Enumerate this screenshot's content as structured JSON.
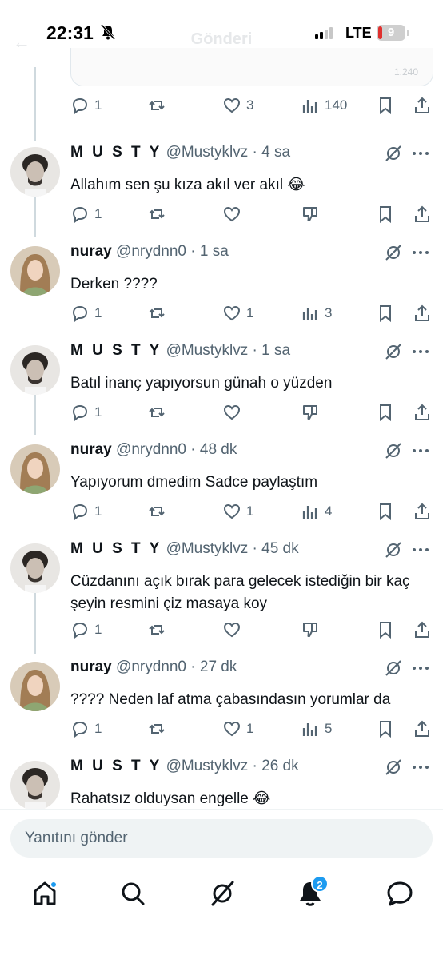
{
  "status_bar": {
    "time": "22:31",
    "network": "LTE",
    "battery": "9"
  },
  "header": {
    "title": "Gönderi"
  },
  "quoted_card": {
    "count": "1.240"
  },
  "top_actions": {
    "replies": "1",
    "likes": "3",
    "views": "140"
  },
  "tweets": [
    {
      "name": "M U S T Y",
      "handle": "@Mustyklvz",
      "time": "4 sa",
      "text": "Allahım sen şu kıza akıl ver akıl 😂",
      "replies": "1",
      "likes": "",
      "views": ""
    },
    {
      "name": "nuray",
      "handle": "@nrydnn0",
      "time": "1 sa",
      "text": "Derken ????",
      "replies": "1",
      "likes": "1",
      "views": "3"
    },
    {
      "name": "M U S T Y",
      "handle": "@Mustyklvz",
      "time": "1 sa",
      "text": "Batıl inanç yapıyorsun günah o yüzden",
      "replies": "1",
      "likes": "",
      "views": ""
    },
    {
      "name": "nuray",
      "handle": "@nrydnn0",
      "time": "48 dk",
      "text": "Yapıyorum dmedim Sadce paylaştım",
      "replies": "1",
      "likes": "1",
      "views": "4"
    },
    {
      "name": "M U S T Y",
      "handle": "@Mustyklvz",
      "time": "45 dk",
      "text": "Cüzdanını açık bırak para gelecek istediğin bir kaç şeyin resmini çiz masaya koy",
      "replies": "1",
      "likes": "",
      "views": ""
    },
    {
      "name": "nuray",
      "handle": "@nrydnn0",
      "time": "27 dk",
      "text": "???? Neden laf atma çabasındasın yorumlar da",
      "replies": "1",
      "likes": "1",
      "views": "5"
    },
    {
      "name": "M U S T Y",
      "handle": "@Mustyklvz",
      "time": "26 dk",
      "text": "Rahatsız olduysan engelle 😂"
    }
  ],
  "reply_bar": {
    "placeholder": "Yanıtını gönder"
  },
  "tab_bar": {
    "notifications_badge": "2"
  },
  "colors": {
    "accent": "#1d9bf0",
    "text": "#0f1419",
    "muted": "#536471"
  },
  "icons": [
    "reply-icon",
    "retweet-icon",
    "like-icon",
    "views-icon",
    "downvote-icon",
    "bookmark-icon",
    "share-icon",
    "grok-icon",
    "more-icon",
    "home-icon",
    "search-icon",
    "grok-tab-icon",
    "notifications-icon",
    "messages-icon"
  ]
}
